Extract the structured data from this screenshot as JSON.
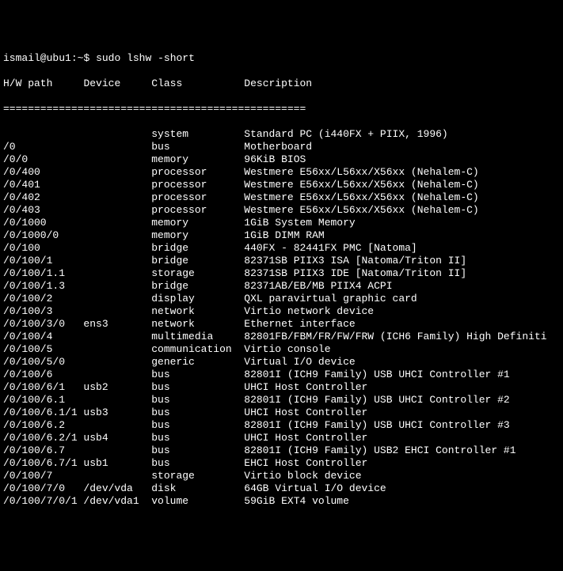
{
  "prompt": {
    "user_host": "ismail@ubu1",
    "sep": ":",
    "path": "~",
    "dollar": "$",
    "command": "sudo lshw -short"
  },
  "header": {
    "col1": "H/W path",
    "col2": "Device",
    "col3": "Class",
    "col4": "Description"
  },
  "divider": "=================================================",
  "chart_data": {
    "type": "table",
    "columns": [
      "H/W path",
      "Device",
      "Class",
      "Description"
    ],
    "rows": [
      [
        "",
        "",
        "system",
        "Standard PC (i440FX + PIIX, 1996)"
      ],
      [
        "/0",
        "",
        "bus",
        "Motherboard"
      ],
      [
        "/0/0",
        "",
        "memory",
        "96KiB BIOS"
      ],
      [
        "/0/400",
        "",
        "processor",
        "Westmere E56xx/L56xx/X56xx (Nehalem-C)"
      ],
      [
        "/0/401",
        "",
        "processor",
        "Westmere E56xx/L56xx/X56xx (Nehalem-C)"
      ],
      [
        "/0/402",
        "",
        "processor",
        "Westmere E56xx/L56xx/X56xx (Nehalem-C)"
      ],
      [
        "/0/403",
        "",
        "processor",
        "Westmere E56xx/L56xx/X56xx (Nehalem-C)"
      ],
      [
        "/0/1000",
        "",
        "memory",
        "1GiB System Memory"
      ],
      [
        "/0/1000/0",
        "",
        "memory",
        "1GiB DIMM RAM"
      ],
      [
        "/0/100",
        "",
        "bridge",
        "440FX - 82441FX PMC [Natoma]"
      ],
      [
        "/0/100/1",
        "",
        "bridge",
        "82371SB PIIX3 ISA [Natoma/Triton II]"
      ],
      [
        "/0/100/1.1",
        "",
        "storage",
        "82371SB PIIX3 IDE [Natoma/Triton II]"
      ],
      [
        "/0/100/1.3",
        "",
        "bridge",
        "82371AB/EB/MB PIIX4 ACPI"
      ],
      [
        "/0/100/2",
        "",
        "display",
        "QXL paravirtual graphic card"
      ],
      [
        "/0/100/3",
        "",
        "network",
        "Virtio network device"
      ],
      [
        "/0/100/3/0",
        "ens3",
        "network",
        "Ethernet interface"
      ],
      [
        "/0/100/4",
        "",
        "multimedia",
        "82801FB/FBM/FR/FW/FRW (ICH6 Family) High Definiti"
      ],
      [
        "/0/100/5",
        "",
        "communication",
        "Virtio console"
      ],
      [
        "/0/100/5/0",
        "",
        "generic",
        "Virtual I/O device"
      ],
      [
        "/0/100/6",
        "",
        "bus",
        "82801I (ICH9 Family) USB UHCI Controller #1"
      ],
      [
        "/0/100/6/1",
        "usb2",
        "bus",
        "UHCI Host Controller"
      ],
      [
        "/0/100/6.1",
        "",
        "bus",
        "82801I (ICH9 Family) USB UHCI Controller #2"
      ],
      [
        "/0/100/6.1/1",
        "usb3",
        "bus",
        "UHCI Host Controller"
      ],
      [
        "/0/100/6.2",
        "",
        "bus",
        "82801I (ICH9 Family) USB UHCI Controller #3"
      ],
      [
        "/0/100/6.2/1",
        "usb4",
        "bus",
        "UHCI Host Controller"
      ],
      [
        "/0/100/6.7",
        "",
        "bus",
        "82801I (ICH9 Family) USB2 EHCI Controller #1"
      ],
      [
        "/0/100/6.7/1",
        "usb1",
        "bus",
        "EHCI Host Controller"
      ],
      [
        "/0/100/7",
        "",
        "storage",
        "Virtio block device"
      ],
      [
        "/0/100/7/0",
        "/dev/vda",
        "disk",
        "64GB Virtual I/O device"
      ],
      [
        "/0/100/7/0/1",
        "/dev/vda1",
        "volume",
        "59GiB EXT4 volume"
      ]
    ]
  }
}
